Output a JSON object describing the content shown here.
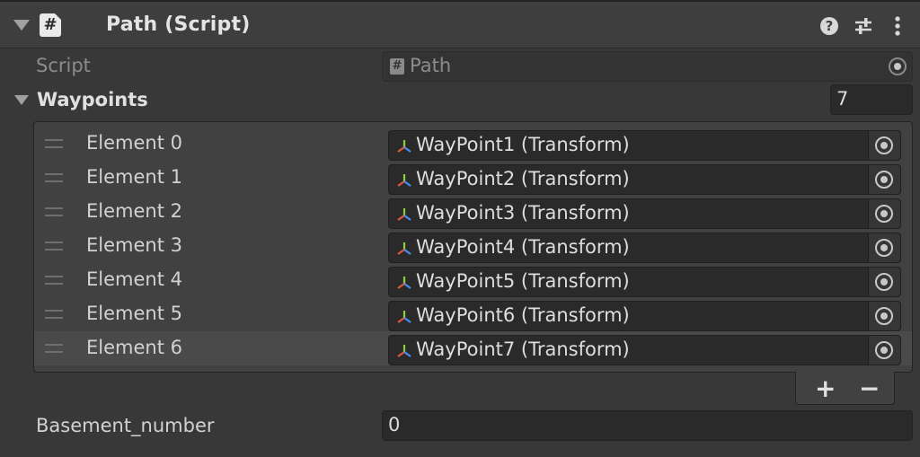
{
  "component": {
    "title": "Path (Script)",
    "script_icon_glyph": "#"
  },
  "script_row": {
    "label": "Script",
    "value": "Path",
    "value_icon_glyph": "#"
  },
  "waypoints": {
    "label": "Waypoints",
    "size": "7",
    "elements": [
      {
        "label": "Element 0",
        "value": "WayPoint1 (Transform)"
      },
      {
        "label": "Element 1",
        "value": "WayPoint2 (Transform)"
      },
      {
        "label": "Element 2",
        "value": "WayPoint3 (Transform)"
      },
      {
        "label": "Element 3",
        "value": "WayPoint4 (Transform)"
      },
      {
        "label": "Element 4",
        "value": "WayPoint5 (Transform)"
      },
      {
        "label": "Element 5",
        "value": "WayPoint6 (Transform)"
      },
      {
        "label": "Element 6",
        "value": "WayPoint7 (Transform)"
      }
    ],
    "add_label": "+",
    "remove_label": "−"
  },
  "basement": {
    "label": "Basement_number",
    "value": "0"
  },
  "colors": {
    "background": "#383838",
    "header_bg": "#3e3e3e",
    "field_bg": "#2a2a2a",
    "selected_row_bg": "#4a4a4a",
    "transform_icon_red": "#e0583c",
    "transform_icon_green": "#8dd13d",
    "transform_icon_blue": "#4a8cf0"
  },
  "icons": {
    "foldout": "triangle-down-icon",
    "script": "script-hash-icon",
    "help": "help-icon",
    "presets": "presets-sliders-icon",
    "menu": "kebab-menu-icon",
    "object_picker": "object-picker-target-icon",
    "transform": "transform-axis-icon",
    "drag_handle": "drag-handle-icon"
  }
}
